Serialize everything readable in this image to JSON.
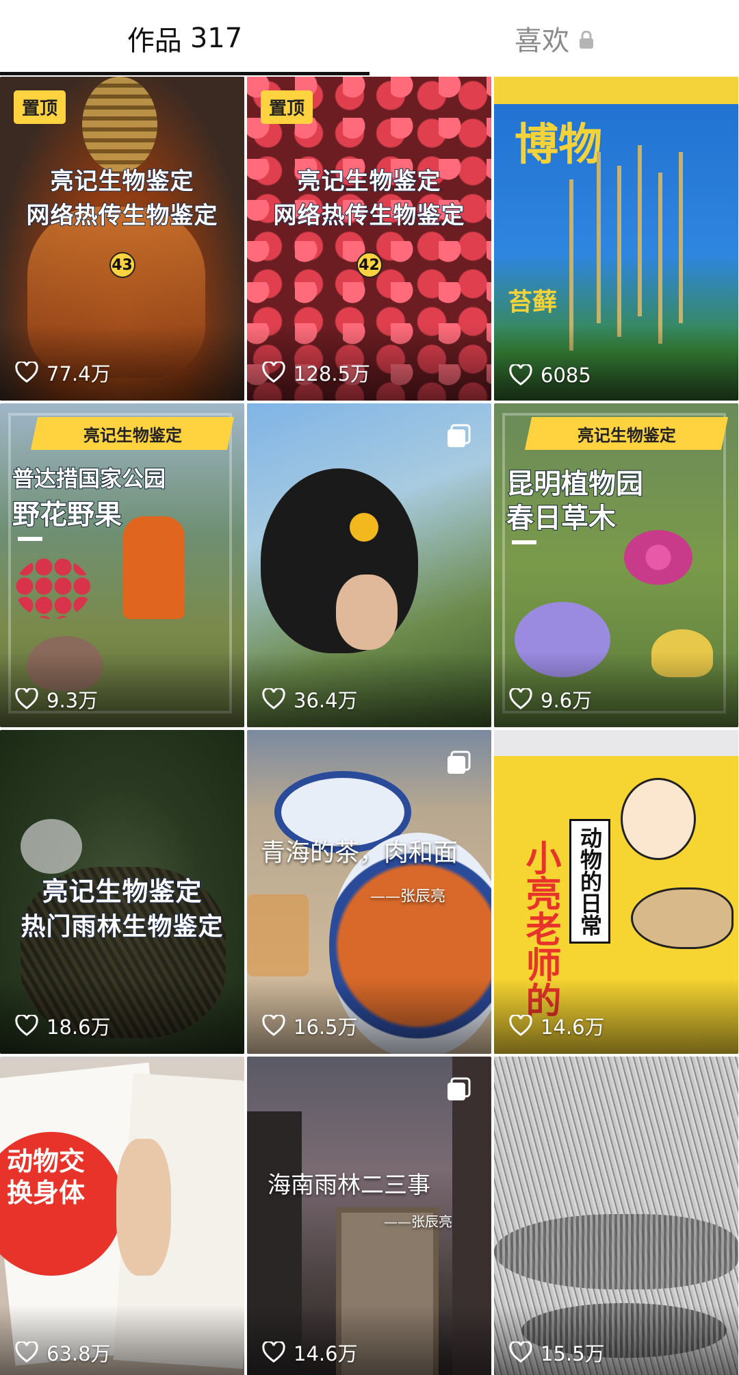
{
  "tabs": {
    "works_label": "作品",
    "works_count": "317",
    "likes_label": "喜欢"
  },
  "pin_label": "置顶",
  "colors": {
    "pin_badge": "#ffd23f",
    "active_tab": "#111111",
    "inactive_tab": "#8a8a8a"
  },
  "videos": [
    {
      "likes": "77.4万",
      "pinned": true,
      "title1": "亮记生物鉴定",
      "title2": "网络热传生物鉴定",
      "episode": "43"
    },
    {
      "likes": "128.5万",
      "pinned": true,
      "title1": "亮记生物鉴定",
      "title2": "网络热传生物鉴定",
      "episode": "42"
    },
    {
      "likes": "6085",
      "cover_title": "博物",
      "cover_subject": "苔藓"
    },
    {
      "likes": "9.3万",
      "banner": "亮记生物鉴定",
      "title1": "普达措国家公园",
      "title2": "野花野果"
    },
    {
      "likes": "36.4万",
      "multi_image": true
    },
    {
      "likes": "9.6万",
      "banner": "亮记生物鉴定",
      "title1": "昆明植物园",
      "title2": "春日草木"
    },
    {
      "likes": "18.6万",
      "title1": "亮记生物鉴定",
      "title2": "热门雨林生物鉴定"
    },
    {
      "likes": "16.5万",
      "multi_image": true,
      "caption": "青海的茶，肉和面",
      "author": "——张辰亮"
    },
    {
      "likes": "14.6万",
      "cover_vertical": "动物的日常",
      "cover_title": "小亮老师的"
    },
    {
      "likes": "63.8万",
      "book_title": "动物交换身体"
    },
    {
      "likes": "14.6万",
      "multi_image": true,
      "caption": "海南雨林二三事",
      "author": "——张辰亮"
    },
    {
      "likes": "15.5万"
    }
  ]
}
